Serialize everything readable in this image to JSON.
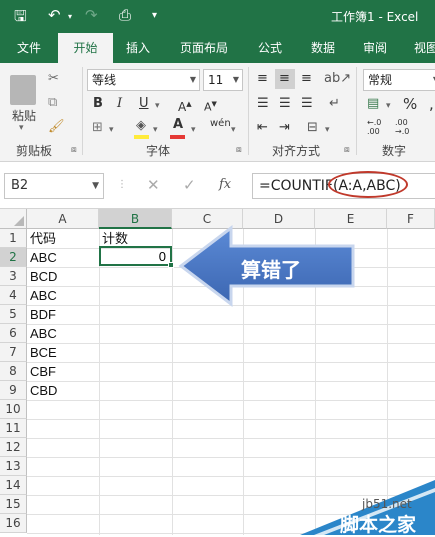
{
  "titlebar": {
    "title": "工作簿1 - Excel",
    "save_icon": "save-icon",
    "undo_icon": "undo-icon",
    "redo_icon": "redo-icon",
    "preview_icon": "print-preview-icon",
    "bg": "#217346"
  },
  "tabs": [
    {
      "label": "文件"
    },
    {
      "label": "开始"
    },
    {
      "label": "插入"
    },
    {
      "label": "页面布局"
    },
    {
      "label": "公式"
    },
    {
      "label": "数据"
    },
    {
      "label": "审阅"
    },
    {
      "label": "视图"
    }
  ],
  "ribbon": {
    "clipboard": {
      "paste_label": "粘贴",
      "group_label": "剪贴板"
    },
    "font": {
      "name": "等线",
      "size": "11",
      "group_label": "字体",
      "bold": "B",
      "italic": "I",
      "underline": "U",
      "font_color_glyph": "A",
      "phonetic": "wén"
    },
    "alignment": {
      "group_label": "对齐方式"
    },
    "number": {
      "format": "常规",
      "group_label": "数字",
      "percent": "%",
      "comma": ","
    }
  },
  "formula_bar": {
    "name_box": "B2",
    "fx": "fx",
    "formula": "=COUNTIF(A:A,ABC)"
  },
  "sheet": {
    "columns": [
      "A",
      "B",
      "C",
      "D",
      "E",
      "F"
    ],
    "selected_column": "B",
    "rows": [
      "1",
      "2",
      "3",
      "4",
      "5",
      "6",
      "7",
      "8",
      "9",
      "10",
      "11",
      "12",
      "13",
      "14",
      "15",
      "16"
    ],
    "selected_row": "2",
    "cells": [
      {
        "ref": "A1",
        "value": "代码"
      },
      {
        "ref": "B1",
        "value": "计数"
      },
      {
        "ref": "A2",
        "value": "ABC"
      },
      {
        "ref": "A3",
        "value": "BCD"
      },
      {
        "ref": "A4",
        "value": "ABC"
      },
      {
        "ref": "A5",
        "value": "BDF"
      },
      {
        "ref": "A6",
        "value": "ABC"
      },
      {
        "ref": "A7",
        "value": "BCE"
      },
      {
        "ref": "A8",
        "value": "CBF"
      },
      {
        "ref": "A9",
        "value": "CBD"
      }
    ],
    "active_cell": {
      "ref": "B2",
      "value": "0"
    }
  },
  "annotation": {
    "callout_text": "算错了",
    "arrow_color": "#4472c4",
    "ellipse_color": "#c0392b"
  },
  "watermark": {
    "site": "jb51.net",
    "name": "脚本之家"
  }
}
